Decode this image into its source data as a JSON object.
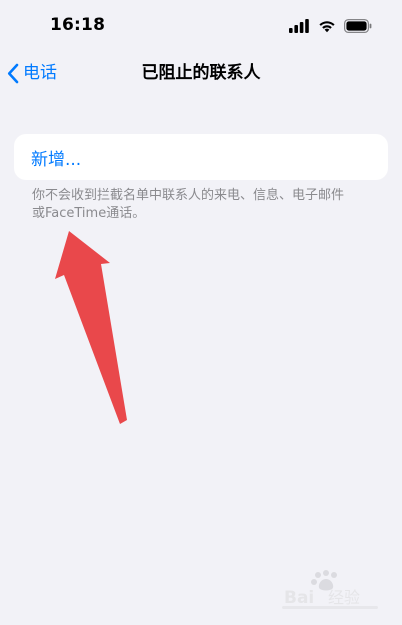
{
  "status_bar": {
    "time": "16:18",
    "icons": [
      "cellular-signal-icon",
      "wifi-icon",
      "battery-icon"
    ]
  },
  "nav": {
    "back_label": "电话",
    "title": "已阻止的联系人"
  },
  "section": {
    "action_label": "新增...",
    "footer_line1": "你不会收到拦截名单中联系人的来电、信息、电子邮件",
    "footer_line2": "或FaceTime通话。"
  },
  "annotation": {
    "color": "#e9484b"
  },
  "colors": {
    "accent": "#007aff",
    "background": "#f2f2f7",
    "card": "#ffffff",
    "footer_text": "#8a8a8e"
  },
  "watermark": {
    "text": "Bai 经验"
  }
}
